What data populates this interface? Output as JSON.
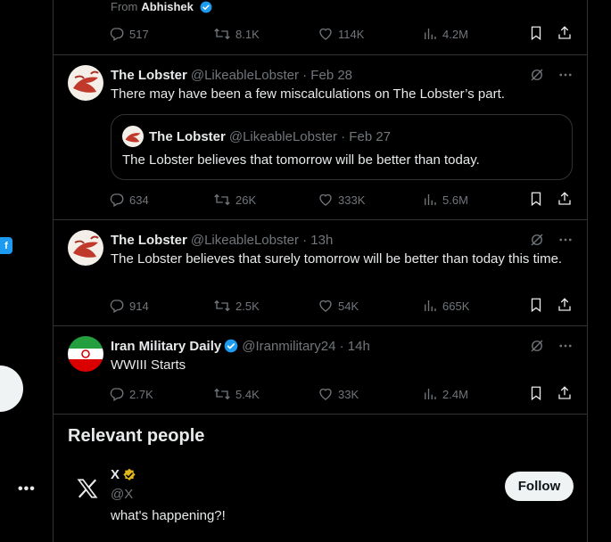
{
  "top_tweet": {
    "from_prefix": "From",
    "from_name": "Abhishek",
    "stats": {
      "replies": "517",
      "reposts": "8.1K",
      "likes": "114K",
      "views": "4.2M"
    }
  },
  "tweets": [
    {
      "name": "The Lobster",
      "handle": "@LikeableLobster · Feb 28",
      "text": "There may have been a few miscalculations on The Lobster’s part.",
      "quote": {
        "name": "The Lobster",
        "handle": "@LikeableLobster · Feb 27",
        "text": "The Lobster believes that tomorrow will be better than today."
      },
      "stats": {
        "replies": "634",
        "reposts": "26K",
        "likes": "333K",
        "views": "5.6M"
      }
    },
    {
      "name": "The Lobster",
      "handle": "@LikeableLobster · 13h",
      "text": "The Lobster believes that surely tomorrow will be better than today this time.",
      "stats": {
        "replies": "914",
        "reposts": "2.5K",
        "likes": "54K",
        "views": "665K"
      }
    },
    {
      "name": "Iran Military Daily",
      "handle": "@Iranmilitary24 · 14h",
      "text": "WWIII Starts",
      "stats": {
        "replies": "2.7K",
        "reposts": "5.4K",
        "likes": "33K",
        "views": "2.4M"
      }
    }
  ],
  "relevant_people": {
    "title": "Relevant people",
    "person": {
      "name": "X",
      "handle": "@X",
      "bio": "what's happening?!",
      "follow_label": "Follow"
    }
  },
  "left_rail": {
    "badge": "f",
    "more": "•••"
  },
  "colors": {
    "background": "#000000",
    "text": "#e7e9ea",
    "muted": "#71767b",
    "border": "#2f3336",
    "verified_blue": "#1d9bf0",
    "verified_gold": "#e2b719"
  },
  "icons": [
    "reply-icon",
    "repost-icon",
    "like-icon",
    "views-icon",
    "bookmark-icon",
    "share-icon",
    "grok-icon",
    "more-icon",
    "verified-icon",
    "x-logo-icon"
  ]
}
